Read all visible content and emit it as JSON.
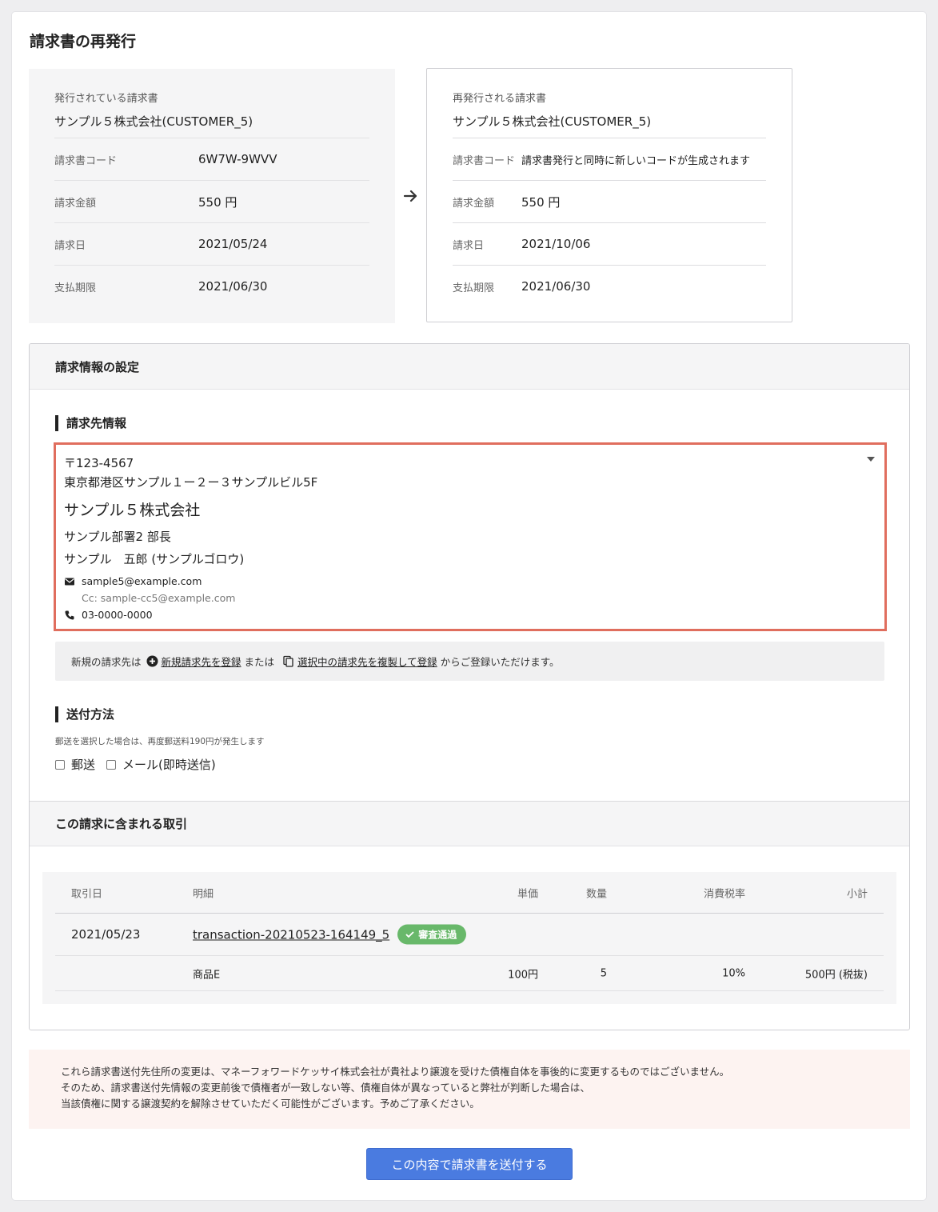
{
  "page": {
    "title": "請求書の再発行"
  },
  "issued_invoice": {
    "caption": "発行されている請求書",
    "customer": "サンプル５株式会社(CUSTOMER_5)",
    "rows": [
      {
        "label": "請求書コード",
        "value": "6W7W-9WVV"
      },
      {
        "label": "請求金額",
        "value": "550 円"
      },
      {
        "label": "請求日",
        "value": "2021/05/24"
      },
      {
        "label": "支払期限",
        "value": "2021/06/30"
      }
    ]
  },
  "reissued_invoice": {
    "caption": "再発行される請求書",
    "customer": "サンプル５株式会社(CUSTOMER_5)",
    "rows": [
      {
        "label": "請求書コード",
        "value": "請求書発行と同時に新しいコードが生成されます"
      },
      {
        "label": "請求金額",
        "value": "550 円"
      },
      {
        "label": "請求日",
        "value": "2021/10/06"
      },
      {
        "label": "支払期限",
        "value": "2021/06/30"
      }
    ]
  },
  "settings": {
    "header": "請求情報の設定",
    "billing_section": "請求先情報",
    "address": {
      "postal": "〒123-4567",
      "street": "東京都港区サンプル１ー２ー３サンプルビル5F",
      "company": "サンプル５株式会社",
      "department": "サンプル部署2 部長",
      "person": "サンプル　五郎 (サンプルゴロウ)",
      "email": "sample5@example.com",
      "cc": "Cc: sample-cc5@example.com",
      "phone": "03-0000-0000"
    },
    "notice": {
      "prefix": "新規の請求先は",
      "link_new": "新規請求先を登録",
      "middle": "または",
      "link_copy": "選択中の請求先を複製して登録",
      "suffix": "からご登録いただけます。"
    },
    "send_section": "送付方法",
    "send_note": "郵送を選択した場合は、再度郵送料190円が発生します",
    "send_options": [
      {
        "label": "郵送",
        "checked": false
      },
      {
        "label": "メール(即時送信)",
        "checked": false
      }
    ]
  },
  "transactions": {
    "header": "この請求に含まれる取引",
    "columns": {
      "date": "取引日",
      "detail": "明細",
      "unit_price": "単価",
      "quantity": "数量",
      "tax_rate": "消費税率",
      "subtotal": "小計"
    },
    "items": [
      {
        "date": "2021/05/23",
        "id": "transaction-20210523-164149_5",
        "status": "審査通過",
        "status_color": "#68b86a",
        "lines": [
          {
            "name": "商品E",
            "unit_price": "100円",
            "quantity": "5",
            "tax_rate": "10%",
            "subtotal": "500円 (税抜)"
          }
        ]
      }
    ]
  },
  "warning": {
    "lines": [
      "これら請求書送付先住所の変更は、マネーフォワードケッサイ株式会社が貴社より譲渡を受けた債権自体を事後的に変更するものではございません。",
      "そのため、請求書送付先情報の変更前後で債権者が一致しない等、債権自体が異なっていると弊社が判断した場合は、",
      "当該債権に関する譲渡契約を解除させていただく可能性がございます。予めご了承ください。"
    ]
  },
  "submit": {
    "label": "この内容で請求書を送付する",
    "color": "#4a7be0"
  }
}
